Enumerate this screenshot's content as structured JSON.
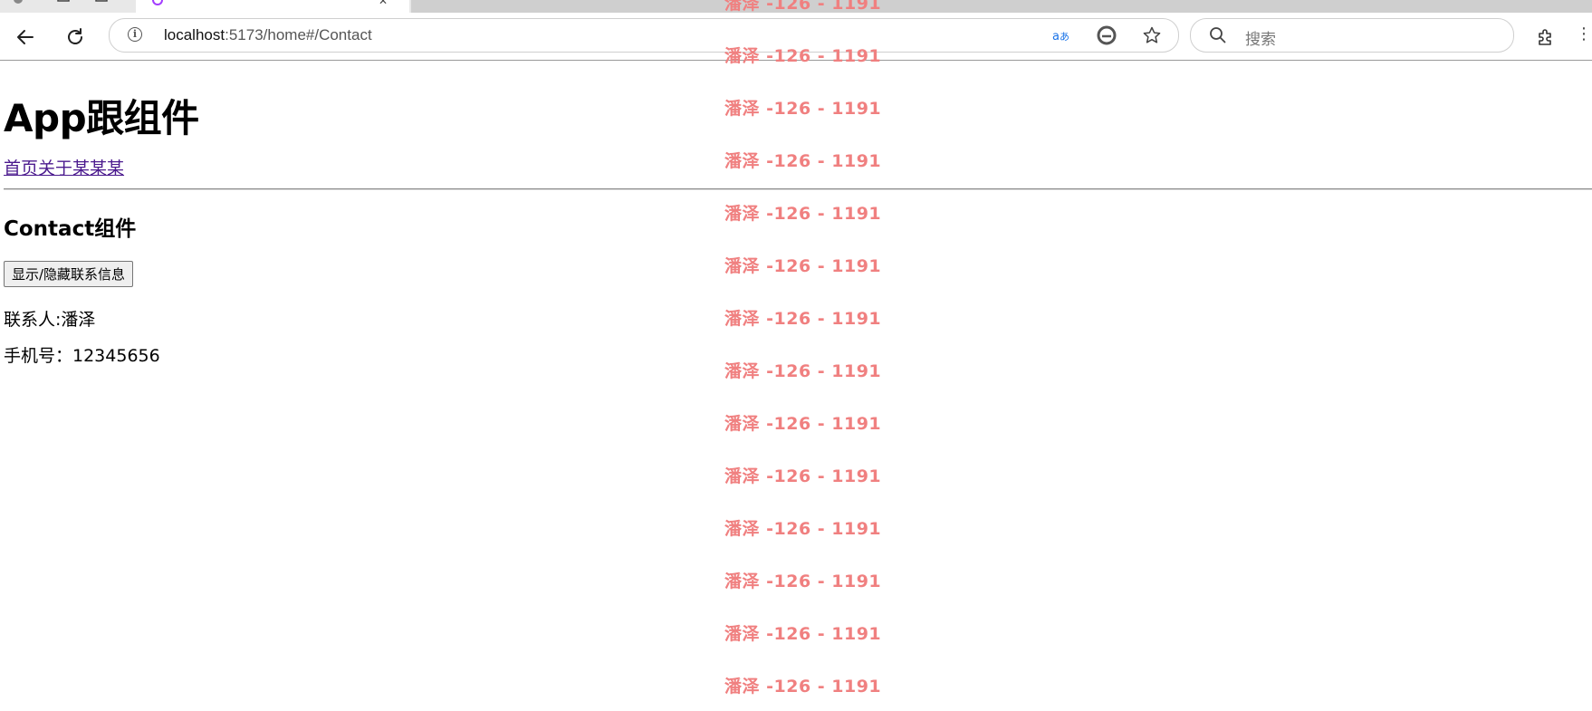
{
  "browser": {
    "address": {
      "host": "localhost",
      "rest": ":5173/home#/Contact"
    },
    "search_placeholder": "搜索",
    "icons": [
      "back-icon",
      "refresh-icon",
      "info-icon",
      "translate-icon",
      "edge-icon",
      "favorite-star-icon",
      "search-icon",
      "extensions-icon",
      "more-icon"
    ]
  },
  "page": {
    "title": "App跟组件",
    "nav_links": [
      "首页",
      "关于",
      "某某某"
    ],
    "section_title": "Contact组件",
    "toggle_button": "显示/隐藏联系信息",
    "contact_person": "联系人:潘泽",
    "phone": "手机号：12345656"
  },
  "watermark": {
    "text": "潘泽 -126 - 1191",
    "color": "#f08080",
    "count": 14
  }
}
